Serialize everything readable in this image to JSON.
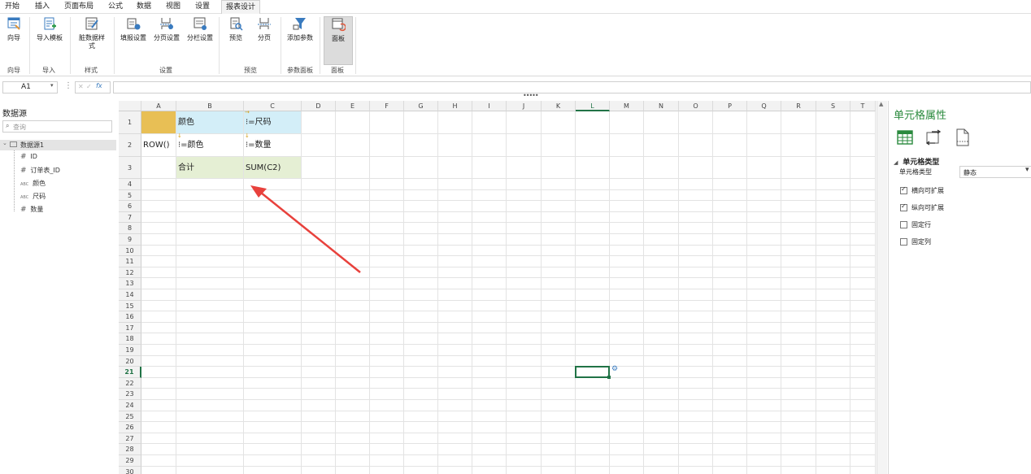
{
  "menu": {
    "items": [
      "开始",
      "插入",
      "页面布局",
      "公式",
      "数据",
      "视图",
      "设置"
    ],
    "active": "报表设计"
  },
  "ribbon": {
    "buttons": [
      "向导",
      "导入模板",
      "脏数据样式",
      "填报设置",
      "分页设置",
      "分栏设置",
      "预览",
      "分页",
      "添加参数",
      "面板"
    ],
    "groups": [
      "向导",
      "导入",
      "样式",
      "设置",
      "预览",
      "参数面板",
      "面板"
    ]
  },
  "formula_bar": {
    "cell_ref": "A1",
    "more": "⋮",
    "cancel": "✕",
    "confirm": "✓",
    "fx": "fx",
    "value": ""
  },
  "datasource": {
    "title": "数据源",
    "search_placeholder": "查询",
    "root": "数据源1",
    "fields": [
      {
        "type": "#",
        "name": "ID"
      },
      {
        "type": "#",
        "name": "订单表_ID"
      },
      {
        "type": "ABC",
        "name": "颜色"
      },
      {
        "type": "ABC",
        "name": "尺码"
      },
      {
        "type": "#",
        "name": "数量"
      }
    ]
  },
  "sheet": {
    "columns": [
      "A",
      "B",
      "C",
      "D",
      "E",
      "F",
      "G",
      "H",
      "I",
      "J",
      "K",
      "L",
      "M",
      "N",
      "O",
      "P",
      "Q",
      "R",
      "S",
      "T"
    ],
    "rows": [
      "1",
      "2",
      "3",
      "4",
      "5",
      "6",
      "7",
      "8",
      "9",
      "10",
      "11",
      "12",
      "13",
      "14",
      "15",
      "16",
      "17",
      "18",
      "19",
      "20",
      "21",
      "22",
      "23",
      "24",
      "25",
      "26",
      "27",
      "28",
      "29",
      "30"
    ],
    "selected_row": "21",
    "selected_col": "L",
    "cells": {
      "b1": "颜色",
      "c1": "⁝=尺码",
      "a2": "ROW()",
      "b2": "⁝=颜色",
      "c2": "⁝=数量",
      "b3": "合计",
      "c3": "SUM(C2)"
    },
    "colors": {
      "a1_fill": "#e8bf55",
      "header_fill": "#d3eef8",
      "total_fill": "#e5efd4",
      "selection": "#217346",
      "arrow": "#e8413c"
    }
  },
  "cell_props": {
    "title": "单元格属性",
    "section": "单元格类型",
    "type_label": "单元格类型",
    "type_value": "静态",
    "options": [
      {
        "label": "横向可扩展",
        "checked": true
      },
      {
        "label": "纵向可扩展",
        "checked": true
      },
      {
        "label": "固定行",
        "checked": false
      },
      {
        "label": "固定列",
        "checked": false
      }
    ]
  }
}
